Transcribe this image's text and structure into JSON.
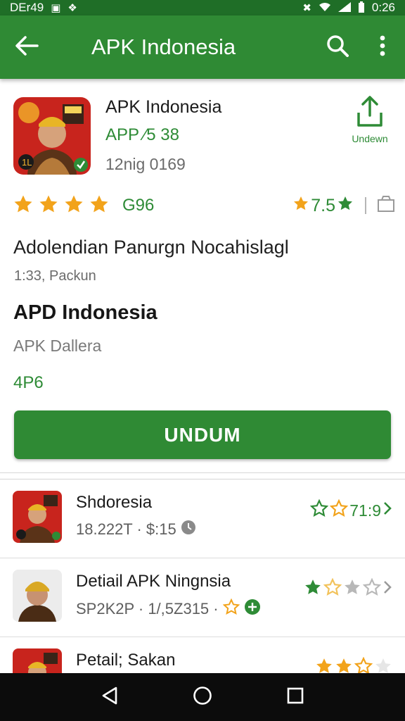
{
  "status_bar": {
    "left_text": "DEr49",
    "time": "0:26"
  },
  "app_bar": {
    "title": "APK Indonesia"
  },
  "detail": {
    "name": "APK Indonesia",
    "version": "APP ⁄5 38",
    "size": "12nig 0169",
    "share_label": "Undewn",
    "rating_count": "G96",
    "score": "7.5",
    "headline": "Adolendian Panurgn Nocahislagl",
    "meta_line": "1:33, Packun",
    "section_title": "APD Indonesia",
    "developer": "APK Dallera",
    "code": "4P6",
    "download_label": "UNDUM",
    "stars": 4
  },
  "list": [
    {
      "title": "Shdoresia",
      "meta": "18.222T · $:15",
      "right_text": "71:9"
    },
    {
      "title": "Detiail APK Ningnsia",
      "meta": "SP2K2P · 1/,5Z315 ·",
      "right_text": ""
    },
    {
      "title": "Petail; Sakan",
      "meta": "",
      "right_text": ""
    }
  ],
  "colors": {
    "primary": "#2f8a34",
    "status": "#1f6e27",
    "accent_green": "#2e8b36",
    "star": "#f2a31b"
  },
  "icons": [
    "back-arrow-icon",
    "search-icon",
    "more-vert-icon",
    "share-upload-icon",
    "bookmark-icon",
    "chevron-right-icon",
    "nav-back-icon",
    "nav-home-icon",
    "nav-recents-icon"
  ]
}
